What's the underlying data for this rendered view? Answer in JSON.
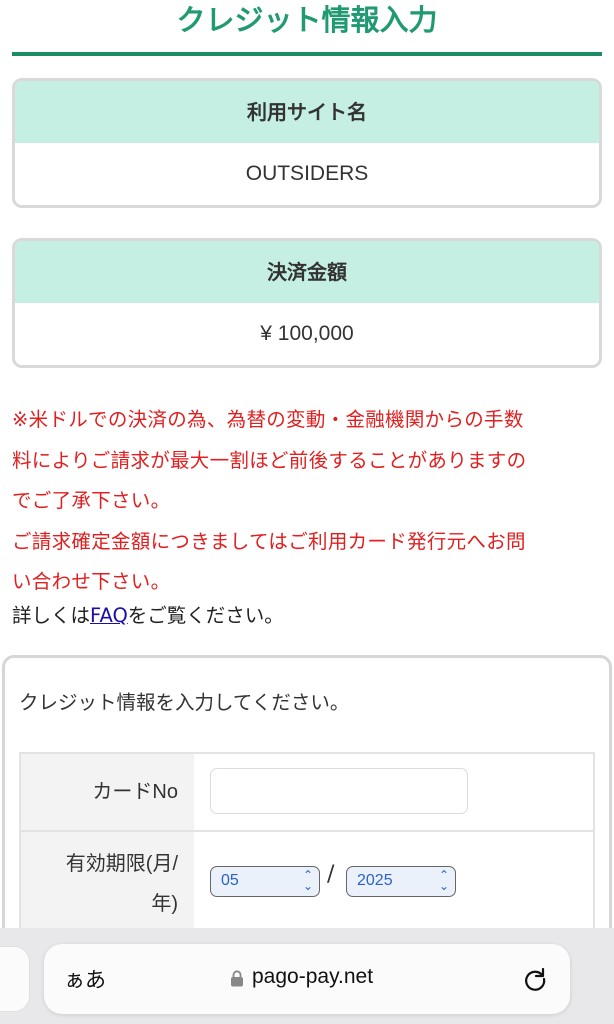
{
  "page": {
    "title": "クレジット情報入力"
  },
  "site_card": {
    "label": "利用サイト名",
    "value": "OUTSIDERS"
  },
  "amount_card": {
    "label": "決済金額",
    "value": "¥ 100,000"
  },
  "notice": {
    "line1": "※米ドルでの決済の為、為替の変動・金融機関からの手数",
    "line2": "料によりご請求が最大一割ほど前後することがありますの",
    "line3": "でご了承下さい。",
    "line4": "ご請求確定金額につきましてはご利用カード発行元へお問",
    "line5": "い合わせ下さい。"
  },
  "faq": {
    "prefix": "詳しくは",
    "link": "FAQ",
    "suffix": "をご覧ください。"
  },
  "form": {
    "intro": "クレジット情報を入力してください。",
    "card_label": "カードNo",
    "card_value": "",
    "expiry_label_line1": "有効期限(月/",
    "expiry_label_line2": "年)",
    "month": "05",
    "year": "2025",
    "separator": "/"
  },
  "browser": {
    "aa_label": "ぁあ",
    "url": "pago-pay.net",
    "icons": [
      "lock-icon",
      "reload-icon"
    ]
  },
  "colors": {
    "title": "#1f9a72",
    "rule": "#1c8d63",
    "card_header": "#c5efe2",
    "notice": "#e02020",
    "link": "#1a0dab"
  }
}
